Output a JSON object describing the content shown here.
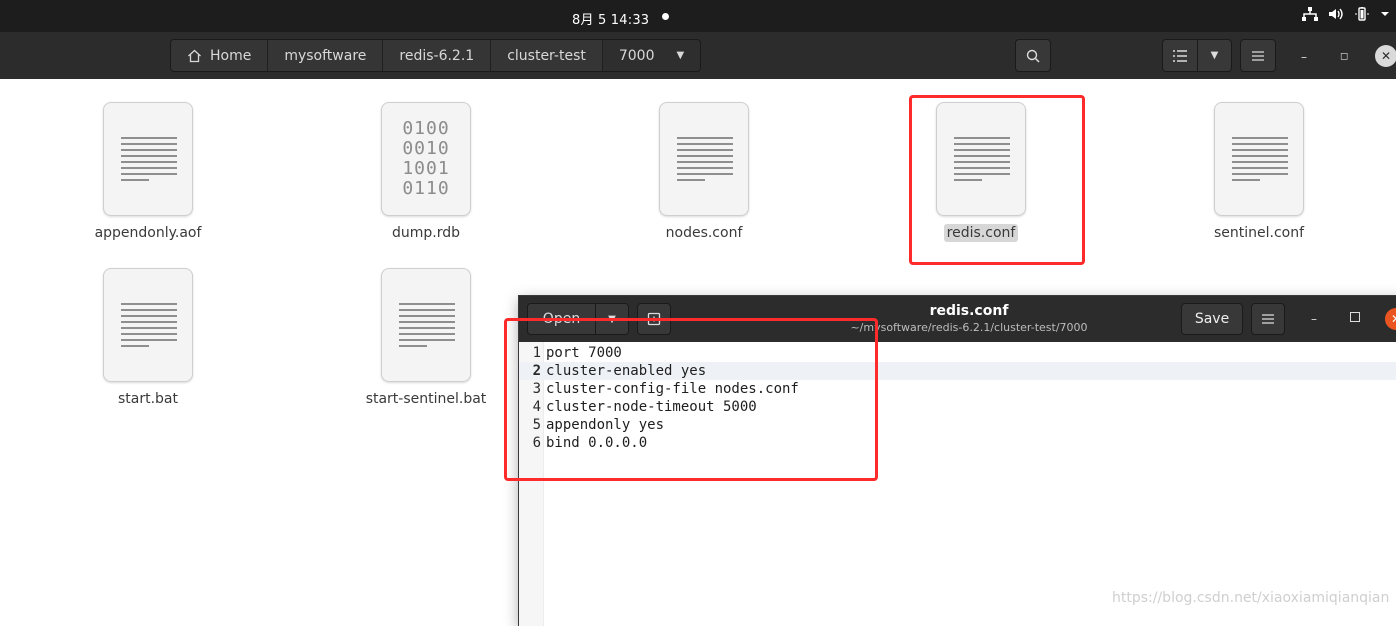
{
  "topbar": {
    "clock": "8月 5  14:33",
    "tray_icons": [
      "network-icon",
      "volume-icon",
      "battery-icon",
      "system-menu-icon"
    ]
  },
  "file_manager": {
    "breadcrumbs": [
      {
        "label": "Home",
        "icon": "home-icon"
      },
      {
        "label": "mysoftware"
      },
      {
        "label": "redis-6.2.1"
      },
      {
        "label": "cluster-test"
      },
      {
        "label": "7000",
        "has_dropdown": true
      }
    ],
    "files": [
      {
        "name": "appendonly.aof",
        "icon": "text-document-icon"
      },
      {
        "name": "dump.rdb",
        "icon": "binary-file-icon",
        "binary": "0100\n0010\n1001\n0110"
      },
      {
        "name": "nodes.conf",
        "icon": "text-document-icon"
      },
      {
        "name": "redis.conf",
        "icon": "text-document-icon",
        "selected": true
      },
      {
        "name": "sentinel.conf",
        "icon": "text-document-icon"
      },
      {
        "name": "start.bat",
        "icon": "text-document-icon"
      },
      {
        "name": "start-sentinel.bat",
        "icon": "text-document-icon"
      }
    ]
  },
  "editor": {
    "open_label": "Open",
    "title": "redis.conf",
    "path": "~/mysoftware/redis-6.2.1/cluster-test/7000",
    "save_label": "Save",
    "current_line": 2,
    "lines": [
      {
        "num": "1",
        "text": "port 7000"
      },
      {
        "num": "2",
        "text": "cluster-enabled yes"
      },
      {
        "num": "3",
        "text": "cluster-config-file nodes.conf"
      },
      {
        "num": "4",
        "text": "cluster-node-timeout 5000"
      },
      {
        "num": "5",
        "text": "appendonly yes"
      },
      {
        "num": "6",
        "text": "bind 0.0.0.0"
      }
    ]
  },
  "watermark": "https://blog.csdn.net/xiaoxiamiqianqian",
  "colors": {
    "highlight_red": "#ff2a2a",
    "close_orange": "#e95420",
    "header_dark": "#2c2c2c"
  }
}
